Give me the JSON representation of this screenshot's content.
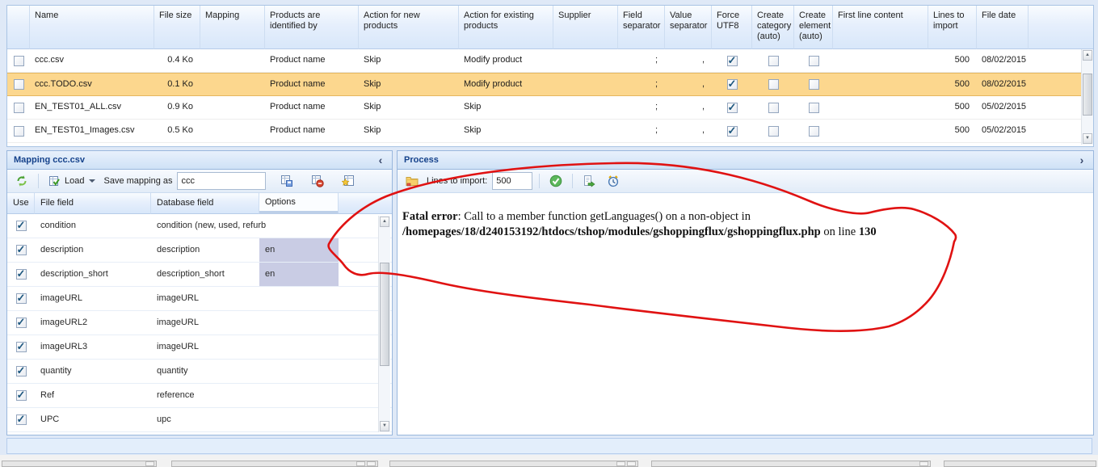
{
  "colors": {
    "accent_blue": "#15428b",
    "selected_row_bg": "#fcd78e",
    "option_cell_bg": "#c9cce4",
    "annotation_red": "#e01212"
  },
  "file_grid": {
    "columns": [
      "Name",
      "File size",
      "Mapping",
      "Products are identified by",
      "Action for new products",
      "Action for existing products",
      "Supplier",
      "Field separator",
      "Value separator",
      "Force UTF8",
      "Create category (auto)",
      "Create element (auto)",
      "First line content",
      "Lines to import",
      "File date"
    ],
    "rows": [
      {
        "name": "ccc.csv",
        "file_size": "0.4 Ko",
        "mapping": "",
        "products_identified_by": "Product name",
        "action_new": "Skip",
        "action_existing": "Modify product",
        "supplier": "",
        "field_separator": ";",
        "value_separator": ",",
        "force_utf8": true,
        "create_category_auto": false,
        "create_element_auto": false,
        "first_line_content": "",
        "lines_to_import": "500",
        "file_date": "08/02/2015",
        "selected": false
      },
      {
        "name": "ccc.TODO.csv",
        "file_size": "0.1 Ko",
        "mapping": "",
        "products_identified_by": "Product name",
        "action_new": "Skip",
        "action_existing": "Modify product",
        "supplier": "",
        "field_separator": ";",
        "value_separator": ",",
        "force_utf8": true,
        "create_category_auto": false,
        "create_element_auto": false,
        "first_line_content": "",
        "lines_to_import": "500",
        "file_date": "08/02/2015",
        "selected": true
      },
      {
        "name": "EN_TEST01_ALL.csv",
        "file_size": "0.9 Ko",
        "mapping": "",
        "products_identified_by": "Product name",
        "action_new": "Skip",
        "action_existing": "Skip",
        "supplier": "",
        "field_separator": ";",
        "value_separator": ",",
        "force_utf8": true,
        "create_category_auto": false,
        "create_element_auto": false,
        "first_line_content": "",
        "lines_to_import": "500",
        "file_date": "05/02/2015",
        "selected": false
      },
      {
        "name": "EN_TEST01_Images.csv",
        "file_size": "0.5 Ko",
        "mapping": "",
        "products_identified_by": "Product name",
        "action_new": "Skip",
        "action_existing": "Skip",
        "supplier": "",
        "field_separator": ";",
        "value_separator": ",",
        "force_utf8": true,
        "create_category_auto": false,
        "create_element_auto": false,
        "first_line_content": "",
        "lines_to_import": "500",
        "file_date": "05/02/2015",
        "selected": false
      }
    ]
  },
  "mapping_panel": {
    "title": "Mapping ccc.csv",
    "collapse_icon": "‹",
    "toolbar": {
      "load_label": "Load",
      "save_mapping_label": "Save mapping as",
      "mapping_name_value": "ccc"
    },
    "columns": [
      "Use",
      "File field",
      "Database field",
      "Options"
    ],
    "rows": [
      {
        "use": true,
        "file_field": "condition",
        "database_field": "condition (new, used, refurb",
        "options": ""
      },
      {
        "use": true,
        "file_field": "description",
        "database_field": "description",
        "options": "en"
      },
      {
        "use": true,
        "file_field": "description_short",
        "database_field": "description_short",
        "options": "en"
      },
      {
        "use": true,
        "file_field": "imageURL",
        "database_field": "imageURL",
        "options": ""
      },
      {
        "use": true,
        "file_field": "imageURL2",
        "database_field": "imageURL",
        "options": ""
      },
      {
        "use": true,
        "file_field": "imageURL3",
        "database_field": "imageURL",
        "options": ""
      },
      {
        "use": true,
        "file_field": "quantity",
        "database_field": "quantity",
        "options": ""
      },
      {
        "use": true,
        "file_field": "Ref",
        "database_field": "reference",
        "options": ""
      },
      {
        "use": true,
        "file_field": "UPC",
        "database_field": "upc",
        "options": ""
      }
    ]
  },
  "process_panel": {
    "title": "Process",
    "expand_icon": "›",
    "toolbar": {
      "lines_to_import_label": "Lines to import:",
      "lines_to_import_value": "500"
    },
    "error_message": {
      "label_bold": "Fatal error",
      "text_after_label": ": Call to a member function getLanguages() on a non-object in ",
      "path_bold": "/homepages/18/d240153192/htdocs/tshop/modules/gshoppingflux/gshoppingflux.php",
      "text_mid": " on line ",
      "line_number_bold": "130"
    }
  }
}
